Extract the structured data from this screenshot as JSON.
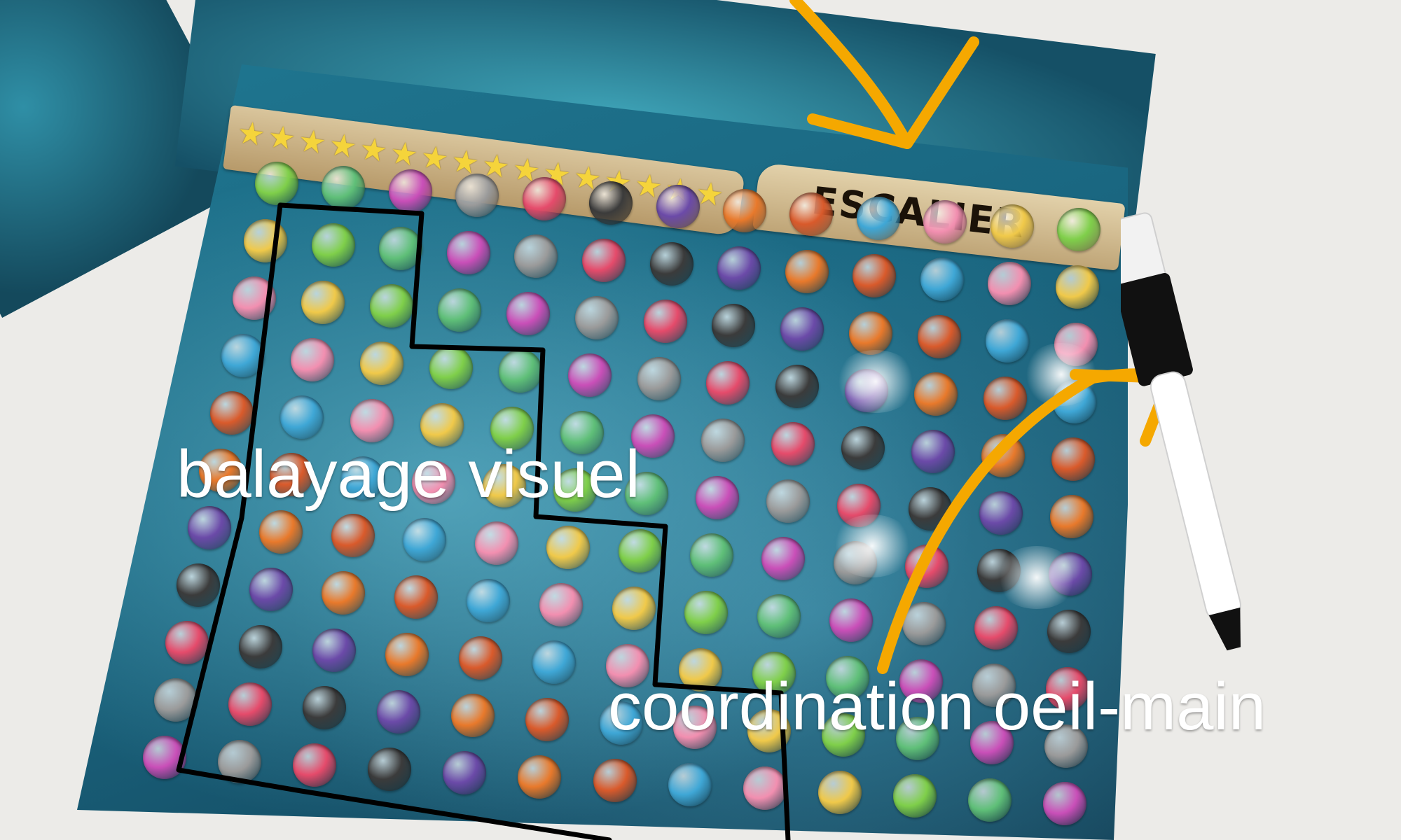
{
  "photo": {
    "board_title": "ESCALIER",
    "star_count": 16,
    "captions": {
      "visual_scanning": "balayage visuel",
      "hand_eye_coordination": "coordination oeil-main"
    },
    "colors": {
      "background": "#ecebe8",
      "board": "#1a6680",
      "banner": "#c9b183",
      "star": "#f5d43b",
      "path_line": "#000000",
      "arrow": "#f5a800",
      "caption": "#ffffff"
    }
  }
}
